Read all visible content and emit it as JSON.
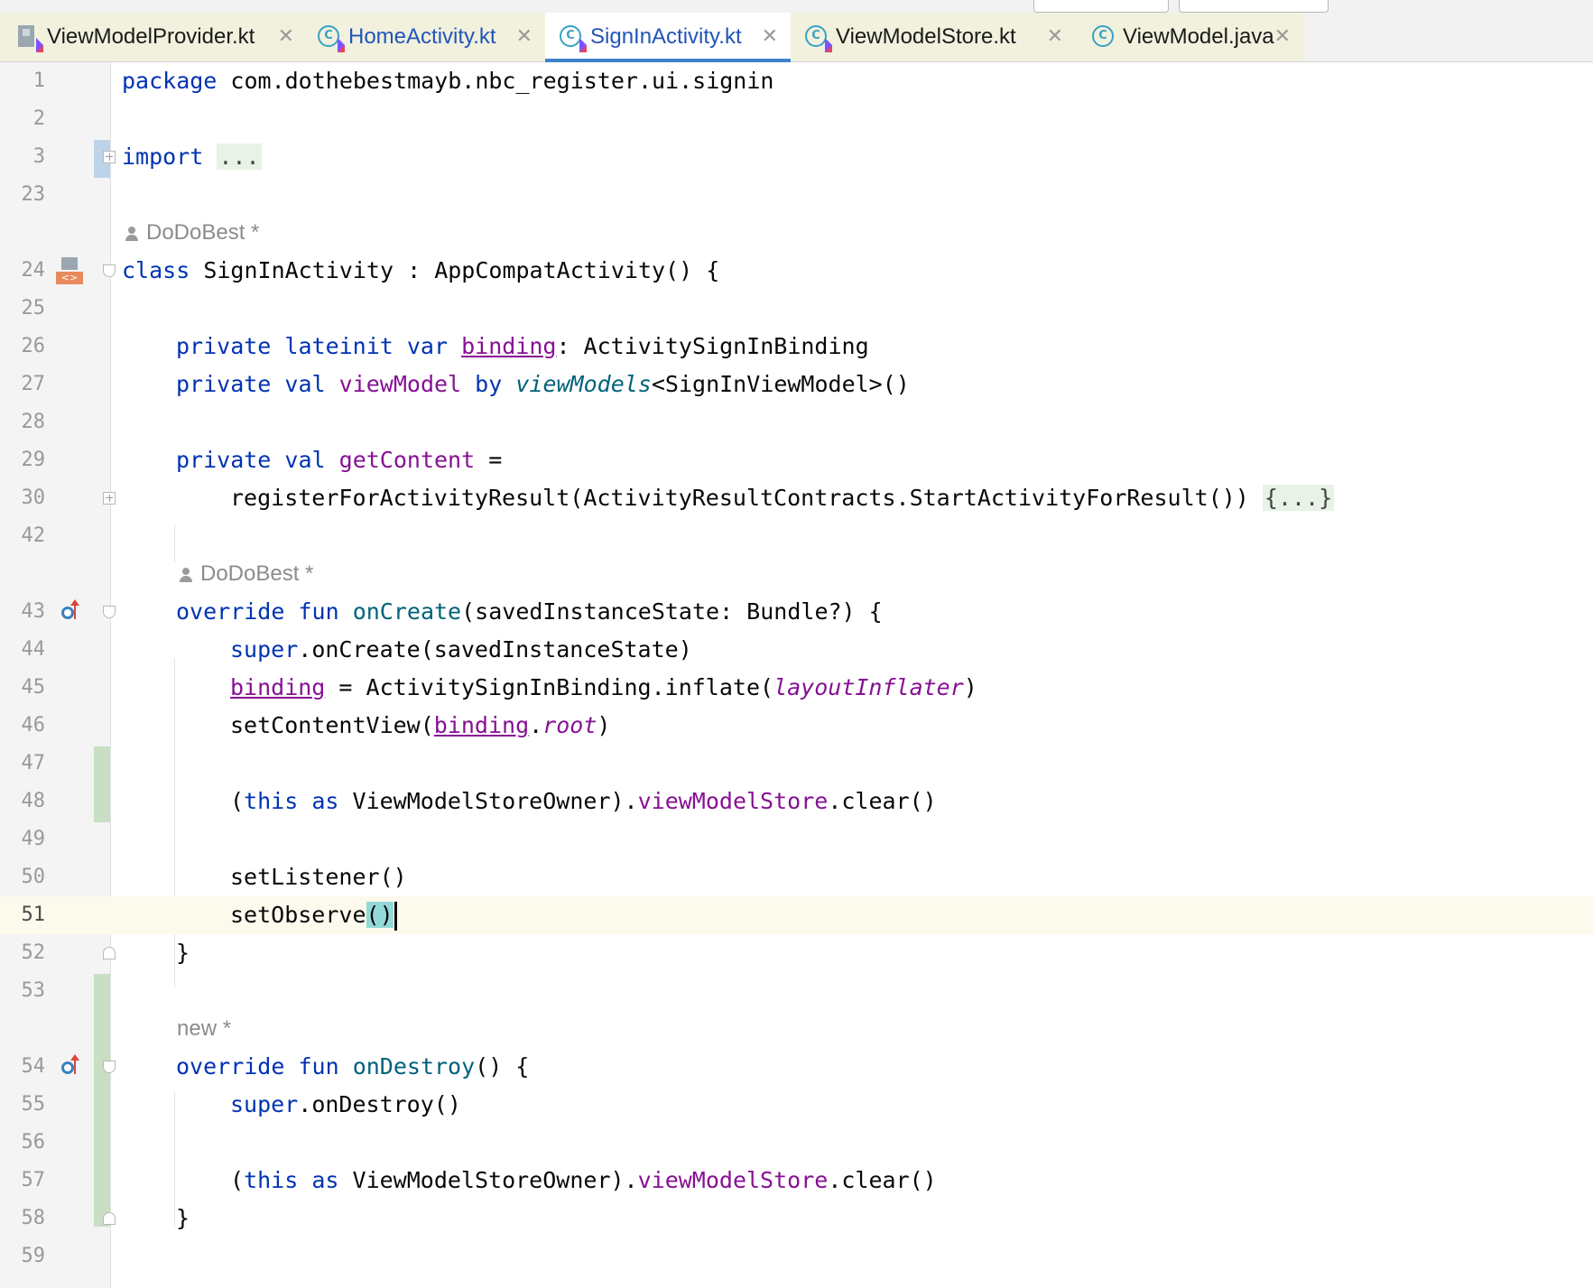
{
  "tabs": [
    {
      "label": "ViewModelProvider.kt",
      "icon": "kotlin-file-icon",
      "active": false
    },
    {
      "label": "HomeActivity.kt",
      "icon": "kotlin-class-icon",
      "active": false
    },
    {
      "label": "SignInActivity.kt",
      "icon": "kotlin-class-icon",
      "active": true
    },
    {
      "label": "ViewModelStore.kt",
      "icon": "kotlin-class-icon",
      "active": false
    },
    {
      "label": "ViewModel.java",
      "icon": "java-class-icon",
      "active": false
    }
  ],
  "tab_close_glyph": "✕",
  "editor": {
    "current_line": "51",
    "line_numbers": [
      "1",
      "2",
      "3",
      "23",
      "24",
      "25",
      "26",
      "27",
      "28",
      "29",
      "30",
      "42",
      "43",
      "44",
      "45",
      "46",
      "47",
      "48",
      "49",
      "50",
      "51",
      "52",
      "53",
      "54",
      "55",
      "56",
      "57",
      "58",
      "59"
    ],
    "inlays": {
      "author1": "DoDoBest *",
      "author2": "DoDoBest *",
      "new": "new *"
    },
    "code": {
      "l1_kw": "package",
      "l1_rest": " com.dothebestmayb.nbc_register.ui.signin",
      "l3_kw": "import",
      "l3_fold": "...",
      "l24_kw": "class",
      "l24_rest": " SignInActivity : AppCompatActivity() {",
      "l26_kw": "private lateinit var",
      "l26_prop": "binding",
      "l26_rest": ": ActivitySignInBinding",
      "l27_kw1": "private val",
      "l27_prop": "viewModel",
      "l27_kw2": "by",
      "l27_ext": "viewModels",
      "l27_rest": "<SignInViewModel>()",
      "l29_kw": "private val",
      "l29_prop": "getContent",
      "l29_rest": " =",
      "l30_code": "registerForActivityResult(ActivityResultContracts.StartActivityForResult())",
      "l30_fold": "{...}",
      "l43_kw": "override fun",
      "l43_fn": "onCreate",
      "l43_rest": "(savedInstanceState: Bundle?) {",
      "l44_kw": "super",
      "l44_rest": ".onCreate(savedInstanceState)",
      "l45_prop": "binding",
      "l45_mid": " = ActivitySignInBinding.inflate(",
      "l45_it": "layoutInflater",
      "l45_end": ")",
      "l46_start": "setContentView(",
      "l46_prop": "binding",
      "l46_dot": ".",
      "l46_it": "root",
      "l46_end": ")",
      "l48_open": "(",
      "l48_kw1": "this",
      "l48_kw2": "as",
      "l48_type": "ViewModelStoreOwner).",
      "l48_prop": "viewModelStore",
      "l48_rest": ".clear()",
      "l50": "setListener()",
      "l51_start": "setObserve",
      "l51_paren": "()",
      "l52": "}",
      "l54_kw": "override fun",
      "l54_fn": "onDestroy",
      "l54_rest": "() {",
      "l55_kw": "super",
      "l55_rest": ".onDestroy()",
      "l57_open": "(",
      "l57_kw1": "this",
      "l57_kw2": "as",
      "l57_type": "ViewModelStoreOwner).",
      "l57_prop": "viewModelStore",
      "l57_rest": ".clear()",
      "l58": "}"
    }
  }
}
